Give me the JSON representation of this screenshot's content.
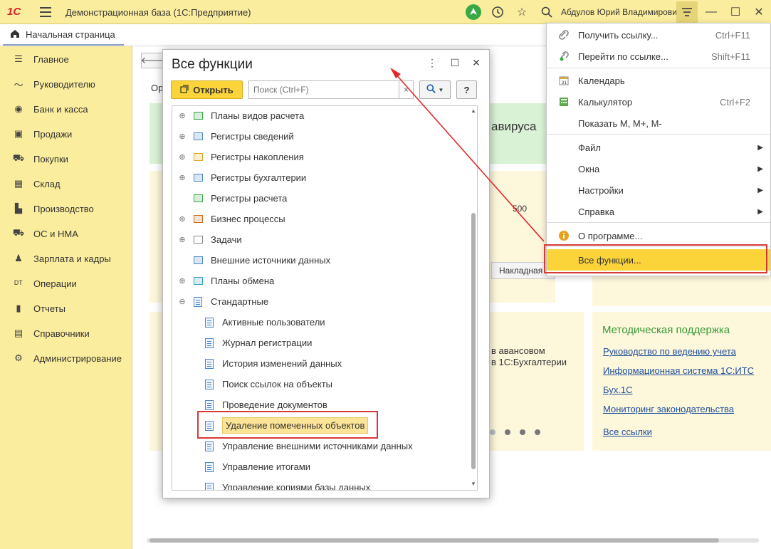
{
  "titlebar": {
    "logo": "1С",
    "app_title": "Демонстрационная база  (1С:Предприятие)",
    "user": "Абдулов Юрий Владимирович"
  },
  "tabs": {
    "home": "Начальная страница"
  },
  "sidebar": {
    "items": [
      {
        "label": "Главное",
        "icon": "list-icon"
      },
      {
        "label": "Руководителю",
        "icon": "trend-icon"
      },
      {
        "label": "Банк и касса",
        "icon": "coin-icon"
      },
      {
        "label": "Продажи",
        "icon": "bag-icon"
      },
      {
        "label": "Покупки",
        "icon": "cart-icon"
      },
      {
        "label": "Склад",
        "icon": "grid-icon"
      },
      {
        "label": "Производство",
        "icon": "factory-icon"
      },
      {
        "label": "ОС и НМА",
        "icon": "truck-icon"
      },
      {
        "label": "Зарплата и кадры",
        "icon": "person-icon"
      },
      {
        "label": "Операции",
        "icon": "dt-kt-icon"
      },
      {
        "label": "Отчеты",
        "icon": "bars-icon"
      },
      {
        "label": "Справочники",
        "icon": "book-icon"
      },
      {
        "label": "Администрирование",
        "icon": "gear-icon"
      }
    ]
  },
  "background": {
    "org_label": "Ор",
    "banner": "авируса",
    "num": "500",
    "tab_nakl": "Накладная",
    "avans_line1": "в авансовом",
    "avans_line2": "в 1С:Бухгалтерии",
    "method_title": "Методическая поддержка",
    "method_links": [
      "Руководство по ведению учета",
      "Информационная система 1С:ИТС",
      "Бух.1С",
      "Мониторинг законодательства",
      "Все ссылки"
    ]
  },
  "dialog": {
    "title": "Все функции",
    "open_label": "Открыть",
    "search_placeholder": "Поиск (Ctrl+F)",
    "help": "?",
    "tree": [
      {
        "label": "Планы видов расчета",
        "level": 0,
        "exp": "⊕"
      },
      {
        "label": "Регистры сведений",
        "level": 0,
        "exp": "⊕"
      },
      {
        "label": "Регистры накопления",
        "level": 0,
        "exp": "⊕"
      },
      {
        "label": "Регистры бухгалтерии",
        "level": 0,
        "exp": "⊕"
      },
      {
        "label": "Регистры расчета",
        "level": 0,
        "exp": ""
      },
      {
        "label": "Бизнес процессы",
        "level": 0,
        "exp": "⊕"
      },
      {
        "label": "Задачи",
        "level": 0,
        "exp": "⊕"
      },
      {
        "label": "Внешние источники данных",
        "level": 0,
        "exp": ""
      },
      {
        "label": "Планы обмена",
        "level": 0,
        "exp": "⊕"
      },
      {
        "label": "Стандартные",
        "level": 0,
        "exp": "⊖"
      },
      {
        "label": "Активные пользователи",
        "level": 1,
        "exp": ""
      },
      {
        "label": "Журнал регистрации",
        "level": 1,
        "exp": ""
      },
      {
        "label": "История изменений данных",
        "level": 1,
        "exp": ""
      },
      {
        "label": "Поиск ссылок на объекты",
        "level": 1,
        "exp": ""
      },
      {
        "label": "Проведение документов",
        "level": 1,
        "exp": ""
      },
      {
        "label": "Удаление помеченных объектов",
        "level": 1,
        "exp": ""
      },
      {
        "label": "Управление внешними источниками данных",
        "level": 1,
        "exp": ""
      },
      {
        "label": "Управление итогами",
        "level": 1,
        "exp": ""
      },
      {
        "label": "Управление копиями базы данных",
        "level": 1,
        "exp": ""
      }
    ]
  },
  "menu": {
    "items": [
      {
        "label": "Получить ссылку...",
        "shortcut": "Ctrl+F11",
        "icon": "link-icon"
      },
      {
        "label": "Перейти по ссылке...",
        "shortcut": "Shift+F11",
        "icon": "go-link-icon"
      },
      {
        "label": "Календарь",
        "shortcut": "",
        "icon": "calendar-icon"
      },
      {
        "label": "Калькулятор",
        "shortcut": "Ctrl+F2",
        "icon": "calculator-icon"
      },
      {
        "label": "Показать М, М+, М-",
        "shortcut": "",
        "icon": ""
      },
      {
        "label": "Файл",
        "shortcut": "",
        "icon": "",
        "submenu": true
      },
      {
        "label": "Окна",
        "shortcut": "",
        "icon": "",
        "submenu": true
      },
      {
        "label": "Настройки",
        "shortcut": "",
        "icon": "",
        "submenu": true
      },
      {
        "label": "Справка",
        "shortcut": "",
        "icon": "",
        "submenu": true
      },
      {
        "label": "О программе...",
        "shortcut": "",
        "icon": "info-icon"
      },
      {
        "label": "Все функции...",
        "shortcut": "",
        "icon": "",
        "active": true
      }
    ]
  },
  "colors": {
    "accent_yellow": "#fbd43a",
    "sidebar_bg": "#fbed9e",
    "link_blue": "#1e4e9c",
    "highlight_red": "#d43a36",
    "method_green": "#3a9a37"
  }
}
